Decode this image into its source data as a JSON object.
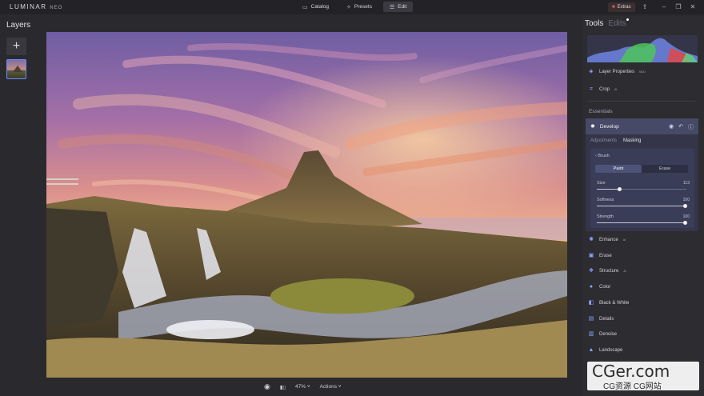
{
  "app": {
    "name": "LUMINAR",
    "suffix": "NEO"
  },
  "topnav": [
    {
      "label": "Catalog",
      "icon": "folder-icon",
      "glyph": "▭"
    },
    {
      "label": "Presets",
      "icon": "sparkle-icon",
      "glyph": "✧"
    },
    {
      "label": "Edit",
      "icon": "sliders-icon",
      "glyph": "☰"
    }
  ],
  "extras": {
    "label": "Extras",
    "glyph": "■"
  },
  "window_buttons": {
    "share": "⇪",
    "minimize": "–",
    "restore": "❐",
    "close": "✕"
  },
  "layers": {
    "title": "Layers",
    "add_glyph": "+"
  },
  "image": {
    "type": "landscape photo"
  },
  "bottom": {
    "eye": "◉",
    "compare": "▮▯",
    "zoom": "47% ˅",
    "actions": "Actions ˅"
  },
  "tools": {
    "tab_tools": "Tools",
    "tab_edits": "Edits",
    "layer_properties": "Layer Properties",
    "layer_properties_badge": "NEO",
    "crop": "Crop",
    "crop_badge": "AI",
    "essentials": "Essentials",
    "develop": {
      "title": "Develop",
      "subtabs": [
        "Adjustments",
        "Masking"
      ],
      "brush": "Brush",
      "modes": [
        "Paint",
        "Erase"
      ],
      "sliders": [
        {
          "label": "Size",
          "value": 113
        },
        {
          "label": "Softness",
          "value": 100
        },
        {
          "label": "Strength",
          "value": 100
        }
      ]
    },
    "items": [
      {
        "label": "Enhance",
        "badge": "AI",
        "icon": "sun-icon",
        "glyph": "✺"
      },
      {
        "label": "Erase",
        "badge": "",
        "icon": "eraser-icon",
        "glyph": "▣"
      },
      {
        "label": "Structure",
        "badge": "AI",
        "icon": "structure-icon",
        "glyph": "❖"
      },
      {
        "label": "Color",
        "badge": "",
        "icon": "color-icon",
        "glyph": "●"
      },
      {
        "label": "Black & White",
        "badge": "",
        "icon": "bw-icon",
        "glyph": "◧"
      },
      {
        "label": "Details",
        "badge": "",
        "icon": "details-icon",
        "glyph": "▤"
      },
      {
        "label": "Denoise",
        "badge": "",
        "icon": "denoise-icon",
        "glyph": "▥"
      },
      {
        "label": "Landscape",
        "badge": "",
        "icon": "landscape-icon",
        "glyph": "▲"
      }
    ]
  },
  "watermark": {
    "line1": "CGer.com",
    "line2": "CG资源 CG网站"
  }
}
